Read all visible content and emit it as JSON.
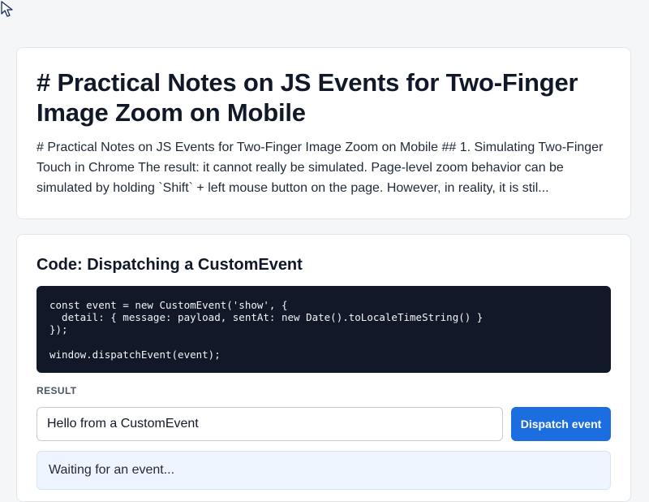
{
  "intro": {
    "title": "# Practical Notes on JS Events for Two-Finger Image Zoom on Mobile",
    "excerpt": "# Practical Notes on JS Events for Two-Finger Image Zoom on Mobile ## 1. Simulating Two-Finger Touch in Chrome The result: it cannot really be simulated. Page-level zoom behavior can be simulated by holding `Shift` + left mouse button on the page. However, in reality, it is stil..."
  },
  "demo": {
    "heading": "Code: Dispatching a CustomEvent",
    "code": "const event = new CustomEvent('show', {\n  detail: { message: payload, sentAt: new Date().toLocaleTimeString() }\n});\n\nwindow.dispatchEvent(event);",
    "result_label": "RESULT",
    "input_value": "Hello from a CustomEvent",
    "button_label": "Dispatch event",
    "output_text": "Waiting for an event..."
  },
  "icons": {
    "cursor": "mouse-pointer-icon"
  },
  "colors": {
    "accent": "#1c6de0",
    "code_bg": "#111827",
    "output_bg": "#eef5ff",
    "page_bg": "#f5f6f8"
  }
}
